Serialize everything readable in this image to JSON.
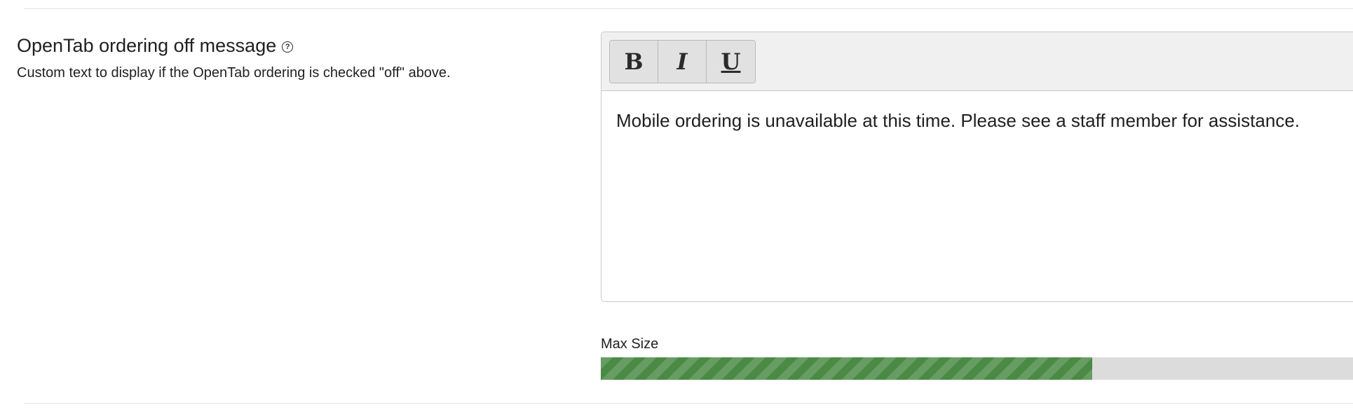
{
  "setting": {
    "title": "OpenTab ordering off message",
    "help_icon": "question-circle-icon",
    "description": "Custom text to display if the OpenTab ordering is checked \"off\" above."
  },
  "editor": {
    "toolbar": {
      "bold_label": "B",
      "italic_label": "I",
      "underline_label": "U"
    },
    "content": "Mobile ordering is unavailable at this time. Please see a staff member for assistance."
  },
  "max_size": {
    "label": "Max Size",
    "fill_fraction": 0.6535,
    "fill_color": "#4a8a45",
    "track_color": "#dcdcdc"
  }
}
